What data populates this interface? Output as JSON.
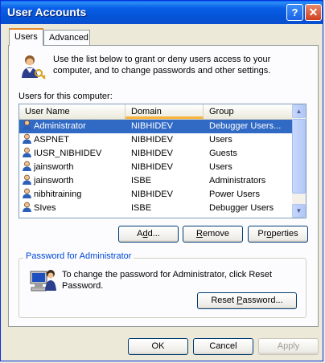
{
  "window": {
    "title": "User Accounts",
    "help_glyph": "?",
    "close_glyph": "✕"
  },
  "tabs": [
    {
      "label": "Users"
    },
    {
      "label": "Advanced"
    }
  ],
  "intro_text": "Use the list below to grant or deny users access to your computer, and to change passwords and other settings.",
  "users_list_label": "Users for this computer:",
  "columns": {
    "name": "User Name",
    "domain": "Domain",
    "group": "Group"
  },
  "rows": [
    {
      "name": "Administrator",
      "domain": "NIBHIDEV",
      "group": "Debugger Users...",
      "selected": true
    },
    {
      "name": "ASPNET",
      "domain": "NIBHIDEV",
      "group": "Users"
    },
    {
      "name": "IUSR_NIBHIDEV",
      "domain": "NIBHIDEV",
      "group": "Guests"
    },
    {
      "name": "jainsworth",
      "domain": "NIBHIDEV",
      "group": "Users"
    },
    {
      "name": "jainsworth",
      "domain": "ISBE",
      "group": "Administrators"
    },
    {
      "name": "nibhitraining",
      "domain": "NIBHIDEV",
      "group": "Power Users"
    },
    {
      "name": "SIves",
      "domain": "ISBE",
      "group": "Debugger Users"
    }
  ],
  "buttons": {
    "add_prefix": "A",
    "add_accel": "d",
    "add_suffix": "d...",
    "remove_prefix": "",
    "remove_accel": "R",
    "remove_suffix": "emove",
    "properties_prefix": "Pr",
    "properties_accel": "o",
    "properties_suffix": "perties",
    "reset_prefix": "Reset ",
    "reset_accel": "P",
    "reset_suffix": "assword...",
    "ok": "OK",
    "cancel": "Cancel",
    "apply": "Apply"
  },
  "password_group": {
    "title": "Password for Administrator",
    "text": "To change the password for Administrator, click Reset Password."
  },
  "colors": {
    "selection": "#316ac5",
    "title_bar": "#0453d6",
    "group_title": "#0046d5"
  }
}
